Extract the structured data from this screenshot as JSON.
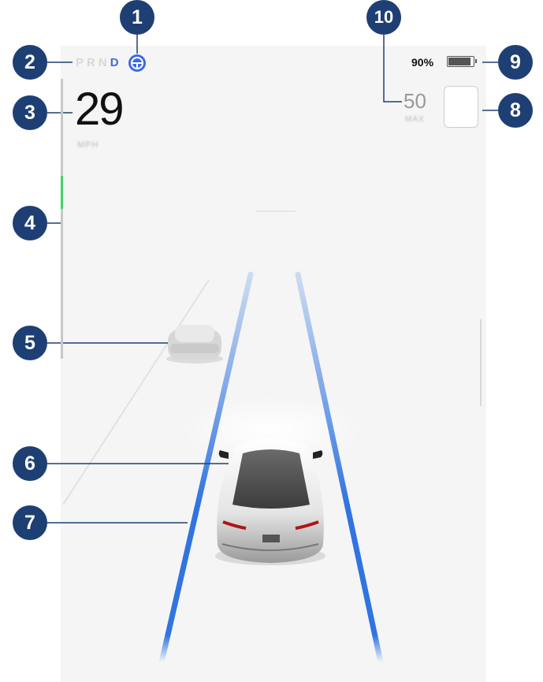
{
  "gear": {
    "p": "P",
    "r": "R",
    "n": "N",
    "d": "D",
    "active": "D"
  },
  "speed": {
    "value": "29",
    "unit": "MPH"
  },
  "battery": {
    "percent": "90%",
    "level": 0.9
  },
  "speed_limit": {
    "value": "50",
    "label": "MAX"
  },
  "callouts": [
    "1",
    "2",
    "3",
    "4",
    "5",
    "6",
    "7",
    "8",
    "9",
    "10"
  ],
  "icons": {
    "autosteer": "steering-wheel-icon"
  },
  "colors": {
    "accent": "#3e6ae1",
    "lane": "#2f74e0",
    "callout": "#1e3f73",
    "pedal": "#44d26a"
  }
}
